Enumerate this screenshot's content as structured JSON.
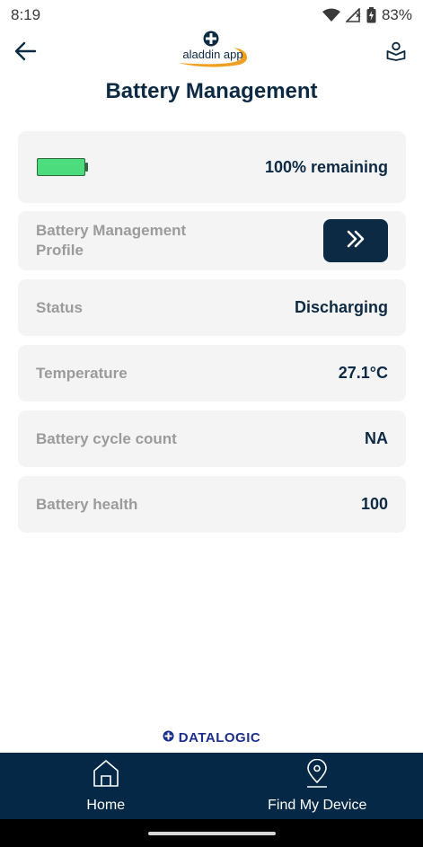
{
  "status_bar": {
    "time": "8:19",
    "battery_percent": "83%"
  },
  "header": {
    "logo_text": "aladdin app",
    "title": "Battery Management"
  },
  "battery_card": {
    "remaining_text": "100% remaining",
    "level": 1.0,
    "fill_color": "#4cdb7d"
  },
  "rows": [
    {
      "label": "Battery Management Profile"
    },
    {
      "label": "Status",
      "value": "Discharging"
    },
    {
      "label": "Temperature",
      "value": "27.1°C"
    },
    {
      "label": "Battery cycle count",
      "value": "NA"
    },
    {
      "label": "Battery health",
      "value": "100"
    }
  ],
  "footer": {
    "brand": "DATALOGIC"
  },
  "bottom_nav": {
    "items": [
      {
        "label": "Home",
        "icon": "home-icon"
      },
      {
        "label": "Find My Device",
        "icon": "location-pin-icon"
      }
    ]
  },
  "colors": {
    "primary": "#0d2a44",
    "nav_background": "#042846",
    "card_background": "#f4f4f4",
    "muted_text": "#9b9b9b",
    "logo_accent": "#f0a020",
    "brand_blue": "#1b2e8c"
  }
}
